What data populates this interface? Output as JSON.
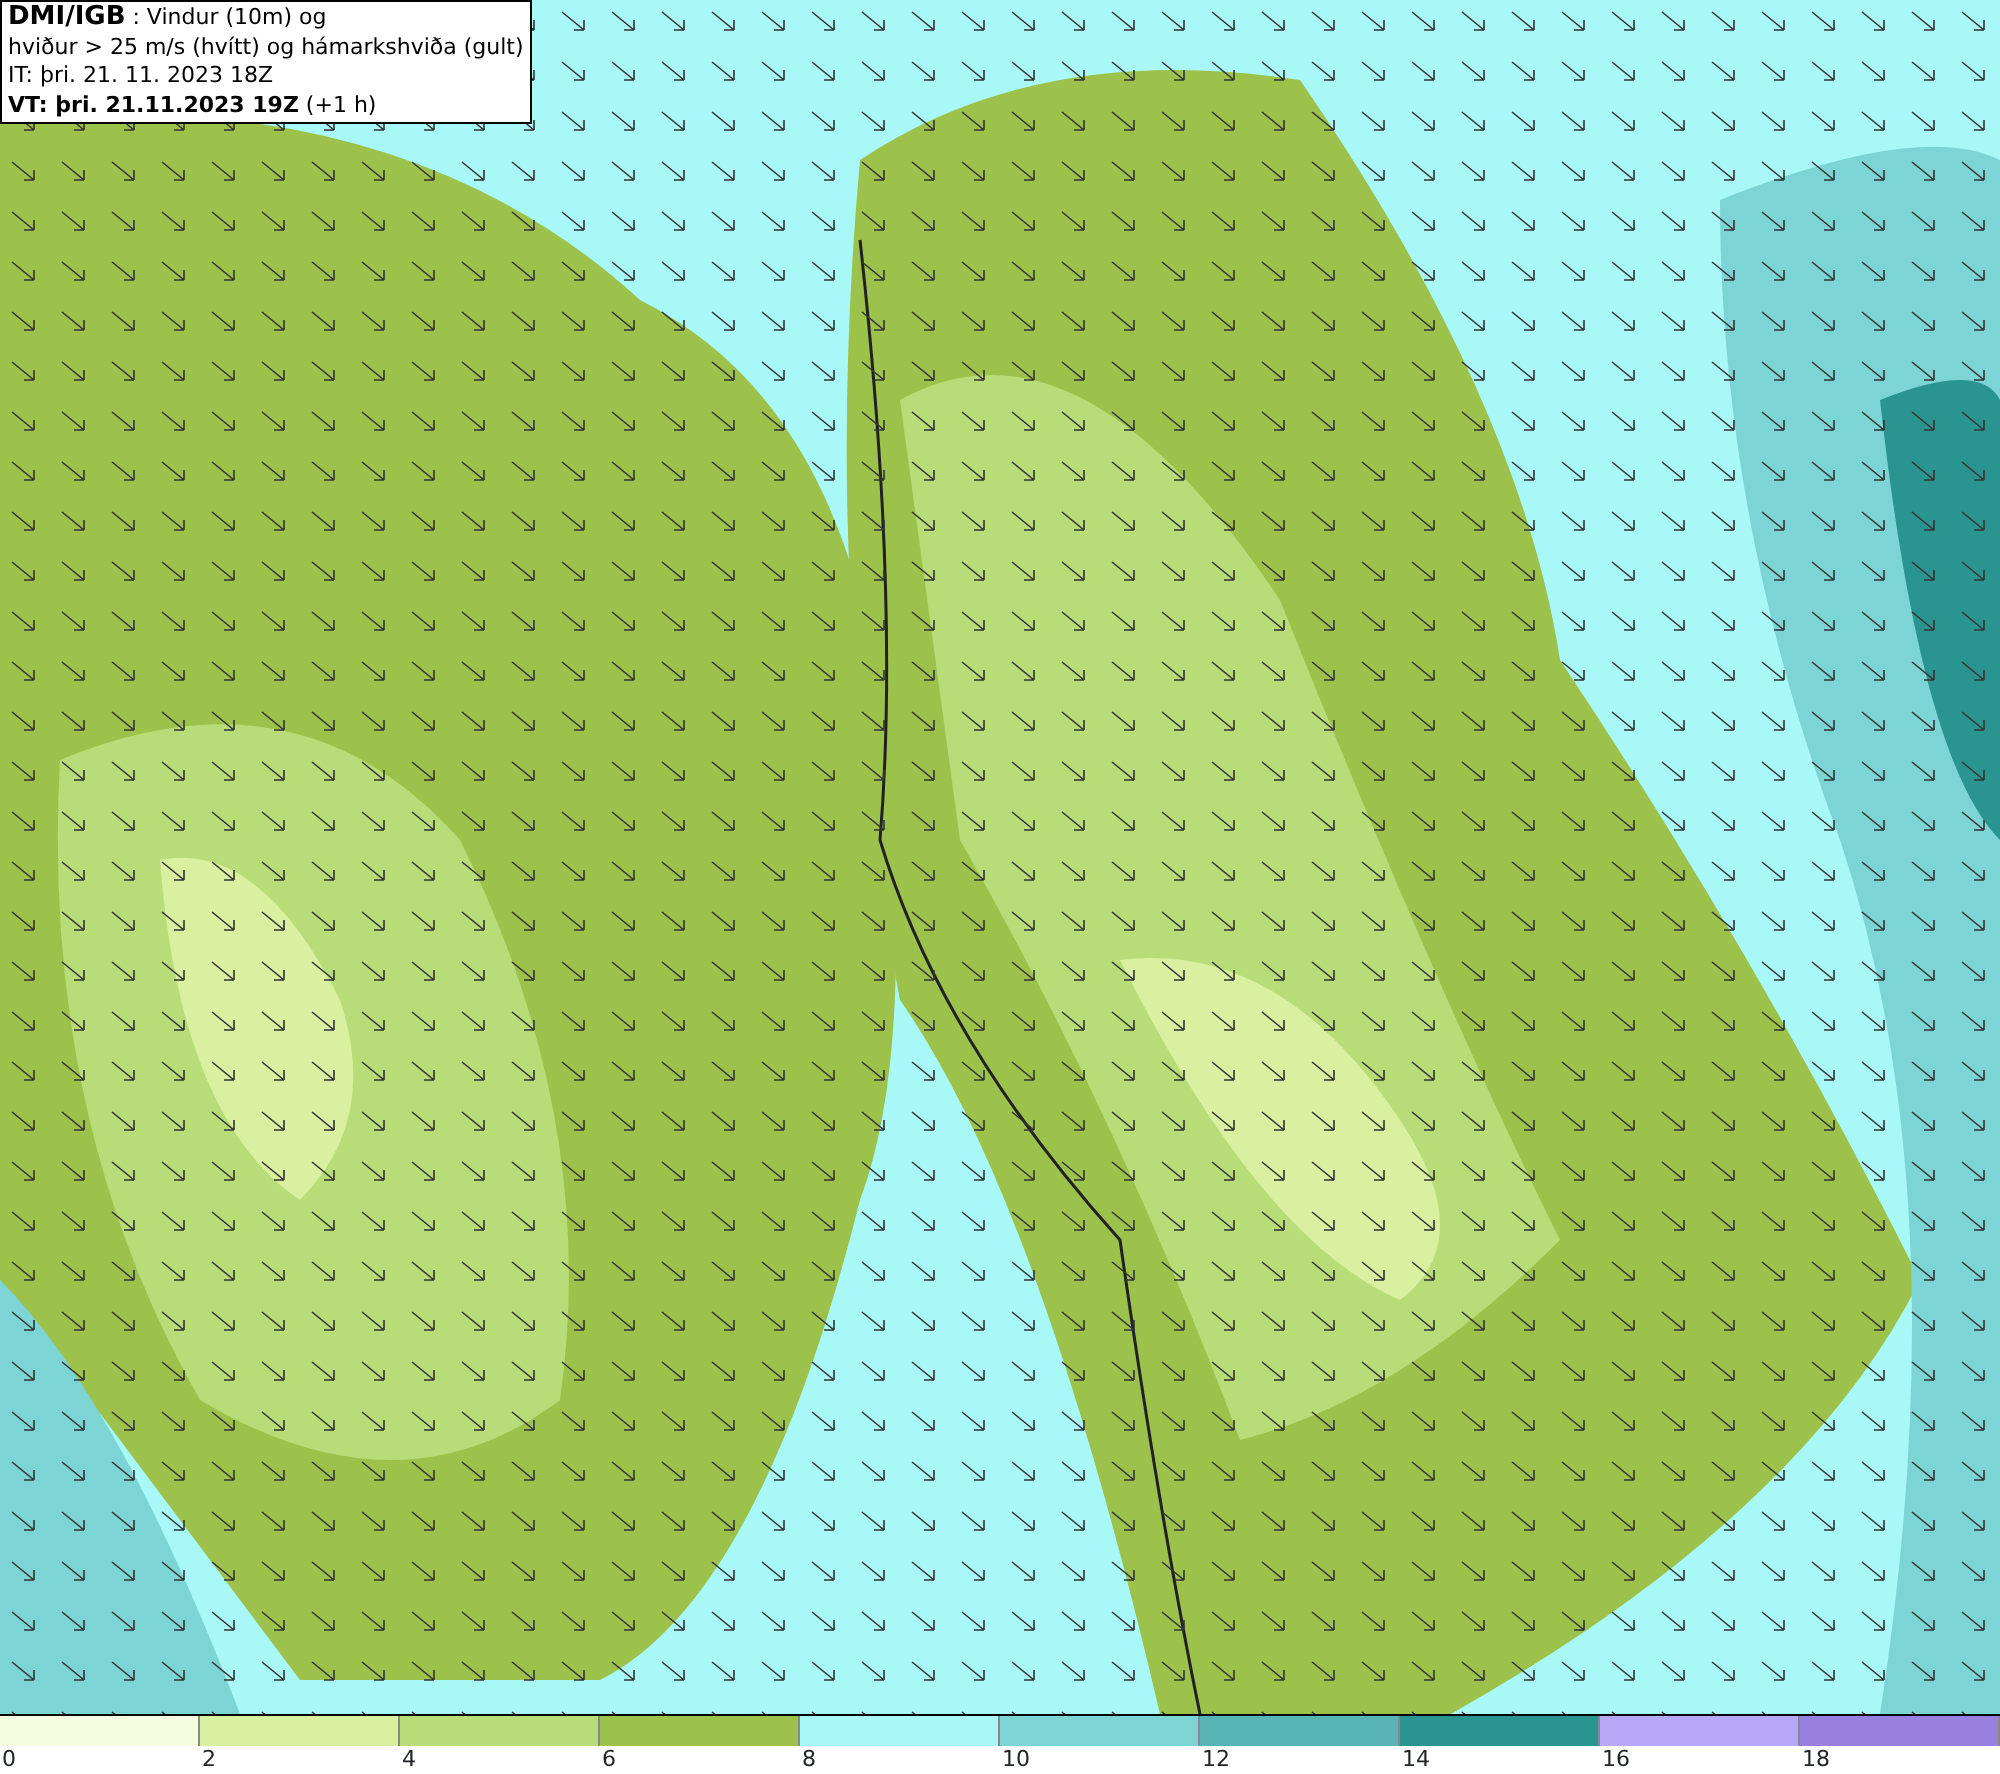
{
  "header": {
    "lines": [
      "**DMI/IGB** : Vindur (10m) og",
      "hviður > 25 m/s (hvítt) og hámarkshviða (gult)",
      "IT: þri. 21. 11. 2023 18Z",
      "**VT: þri. 21.11.2023 19Z** (+1 h)"
    ]
  },
  "legend": {
    "bins": [
      {
        "color": "#f5fce0"
      },
      {
        "color": "#d8f0a0"
      },
      {
        "color": "#b8dc78"
      },
      {
        "color": "#9cc24c"
      },
      {
        "color": "#a8f8f8"
      },
      {
        "color": "#7cd4d4"
      },
      {
        "color": "#58b4b4"
      },
      {
        "color": "#2a9490"
      },
      {
        "color": "#b8a8f8"
      },
      {
        "color": "#9880e0"
      }
    ],
    "ticks": [
      "0",
      "2",
      "4",
      "6",
      "8",
      "10",
      "12",
      "14",
      "16",
      "18"
    ]
  }
}
